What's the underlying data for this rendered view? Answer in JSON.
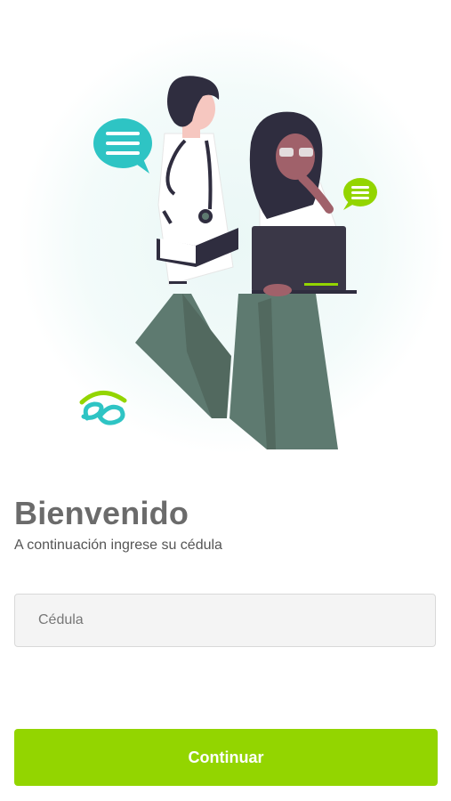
{
  "welcome": {
    "title": "Bienvenido",
    "subtitle": "A continuación ingrese su cédula"
  },
  "form": {
    "cedula_placeholder": "Cédula",
    "cedula_value": "",
    "continue_label": "Continuar"
  },
  "illustration": {
    "subject": "doctor and patient illustration",
    "icons": [
      "chat-bubble-icon",
      "chat-bubble-small-icon",
      "brand-logo-icon"
    ]
  },
  "colors": {
    "accent": "#93d500",
    "brand_teal": "#2ec4c4",
    "heading": "#6b6b6b",
    "input_bg": "#f4f4f4"
  }
}
